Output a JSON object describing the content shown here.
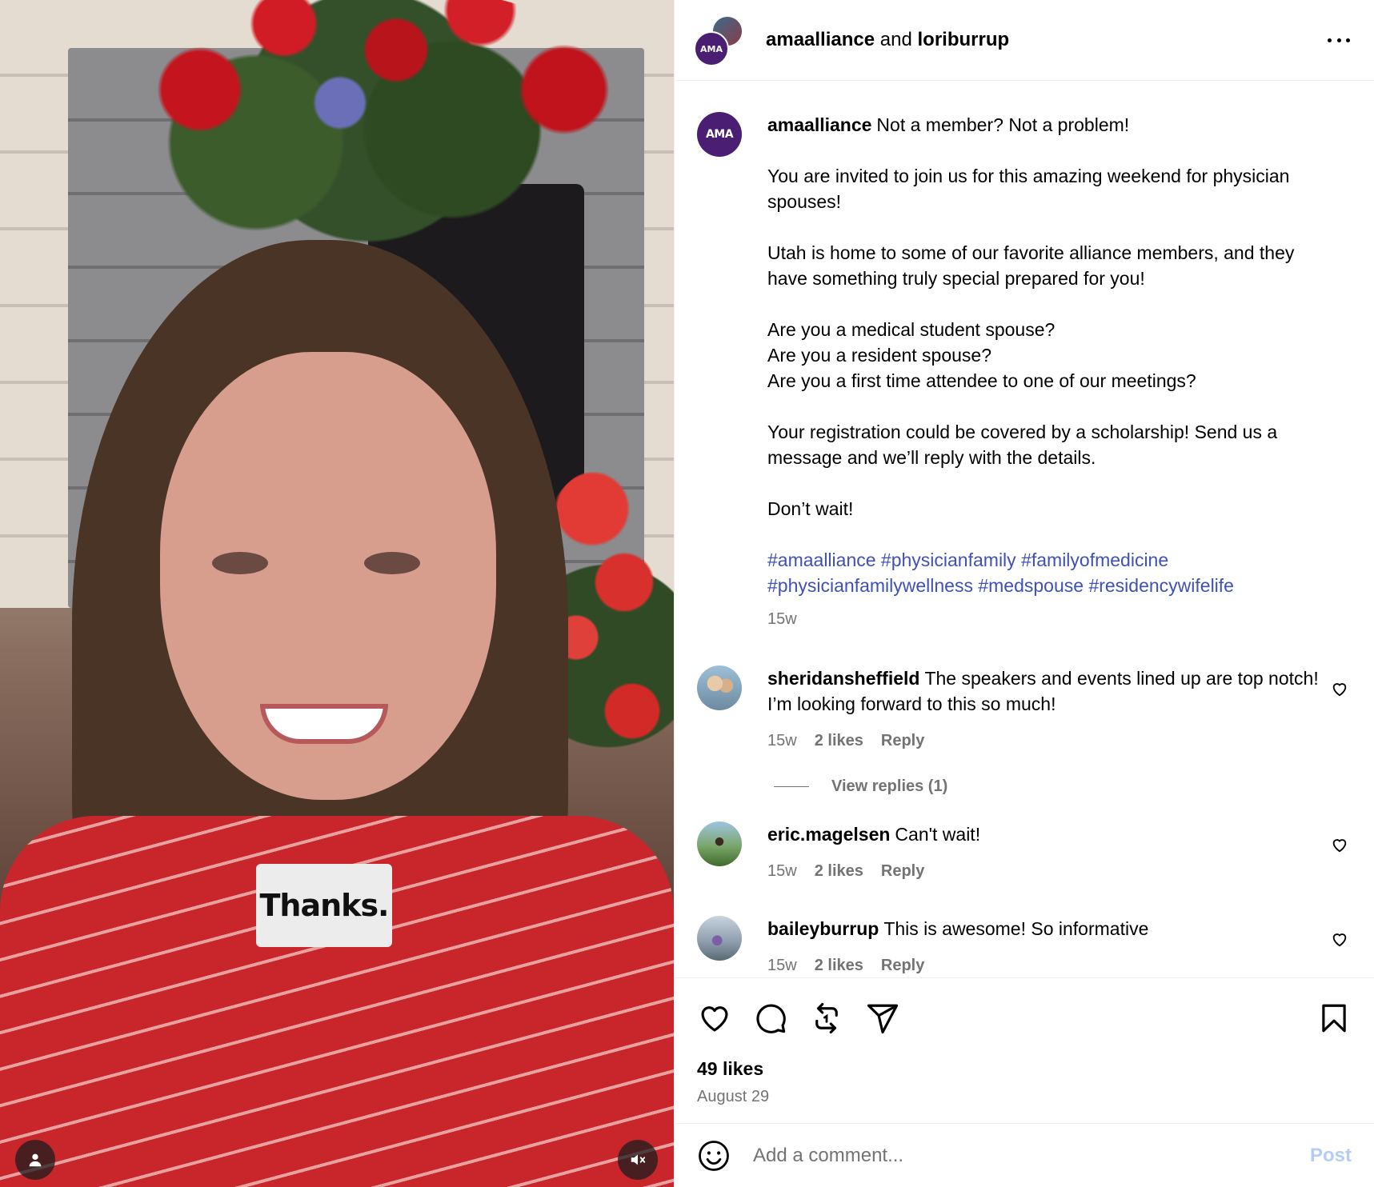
{
  "video": {
    "caption_text": "Thanks."
  },
  "header": {
    "user1": "amaalliance",
    "joiner": "and",
    "user2": "loriburrup",
    "avatar_text": "AMA"
  },
  "post": {
    "username": "amaalliance",
    "avatar_text": "AMA",
    "lines": [
      "Not a member? Not a problem!",
      "You are invited to join us for this amazing weekend for physician spouses!",
      "Utah is home to some of our favorite alliance members, and they have something truly special prepared for you!",
      "Are you a medical student spouse?",
      "Are you a resident spouse?",
      "Are you a first time attendee to one of our meetings?",
      "Your registration could be covered by a scholarship! Send us a message and we’ll reply with the details.",
      "Don’t wait!"
    ],
    "hashtags": [
      "#amaalliance",
      "#physicianfamily",
      "#familyofmedicine",
      "#physicianfamilywellness",
      "#medspouse",
      "#residencywifelife"
    ],
    "time": "15w"
  },
  "comments": [
    {
      "username": "sheridansheffield",
      "text": "The speakers and events lined up are top notch! I’m looking forward to this so much!",
      "time": "15w",
      "likes": "2 likes",
      "reply": "Reply"
    },
    {
      "username": "eric.magelsen",
      "text": "Can't wait!",
      "time": "15w",
      "likes": "2 likes",
      "reply": "Reply"
    },
    {
      "username": "baileyburrup",
      "text": "This is awesome! So informative",
      "time": "15w",
      "likes": "2 likes",
      "reply": "Reply"
    }
  ],
  "view_replies": "View replies (1)",
  "footer": {
    "likes": "49 likes",
    "date": "August 29"
  },
  "comment_input": {
    "placeholder": "Add a comment...",
    "post_label": "Post"
  },
  "colors": {
    "hashtag": "#3f51b5",
    "post_disabled": "#b3cdf7",
    "ama_purple": "#4a1f73"
  },
  "icons": [
    "more-icon",
    "heart-icon",
    "comment-icon",
    "repost-icon",
    "share-icon",
    "bookmark-icon",
    "emoji-icon",
    "user-icon",
    "mute-icon"
  ]
}
